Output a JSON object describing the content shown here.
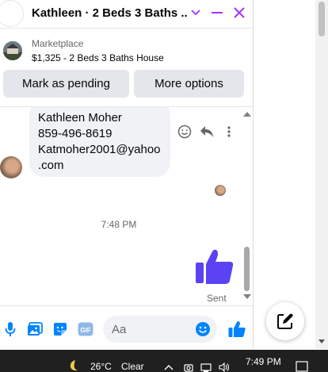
{
  "header": {
    "title": "Kathleen · 2 Beds 3 Baths ...",
    "icons": [
      "chevron-down-icon",
      "minimize-icon",
      "close-icon"
    ],
    "accent_color": "#a334fa"
  },
  "listing": {
    "source": "Marketplace",
    "description": "$1,325 - 2 Beds 3 Baths House",
    "mark_pending_label": "Mark as pending",
    "more_options_label": "More options"
  },
  "messages": {
    "received_lines": [
      "Kathleen Moher",
      "859-496-8619",
      "Katmoher2001@yahoo",
      ".com"
    ],
    "timestamp": "7:48 PM",
    "sent_status": "Sent",
    "message_action_icons": [
      "smile-icon",
      "reply-icon",
      "more-vertical-icon"
    ]
  },
  "composer": {
    "placeholder": "Aa",
    "icons": [
      "microphone-icon",
      "photo-icon",
      "sticker-icon",
      "gif-icon",
      "emoji-icon",
      "thumbs-up-icon"
    ],
    "gif_label": "GIF"
  },
  "taskbar": {
    "temperature": "26°C",
    "weather": "Clear",
    "time": "7:49 PM"
  },
  "colors": {
    "messenger_blue": "#0084ff",
    "like_purple": "#5b42f3",
    "bubble_gray": "#f0f2f5",
    "button_gray": "#e4e6eb",
    "taskbar_bg": "#202020"
  }
}
